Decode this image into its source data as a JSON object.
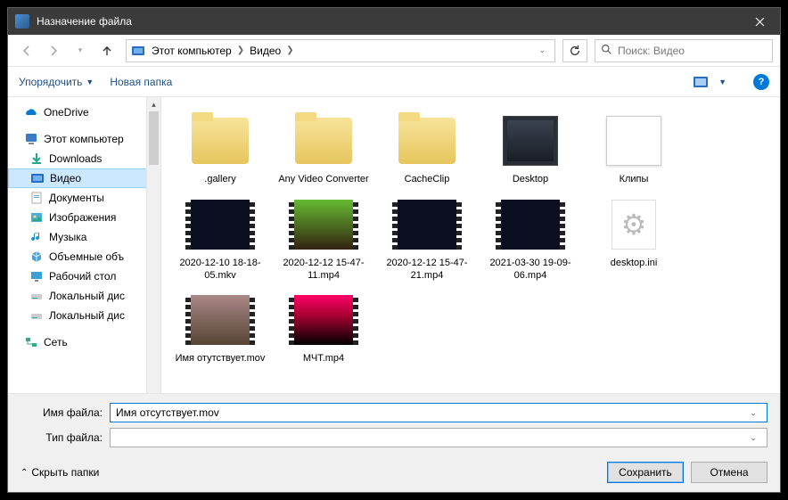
{
  "title": "Назначение файла",
  "breadcrumb": {
    "root": "Этот компьютер",
    "folder": "Видео"
  },
  "search_placeholder": "Поиск: Видео",
  "toolbar": {
    "organize": "Упорядочить",
    "new_folder": "Новая папка"
  },
  "sidebar": {
    "onedrive": "OneDrive",
    "this_pc": "Этот компьютер",
    "items": [
      {
        "label": "Downloads"
      },
      {
        "label": "Видео"
      },
      {
        "label": "Документы"
      },
      {
        "label": "Изображения"
      },
      {
        "label": "Музыка"
      },
      {
        "label": "Объемные объ"
      },
      {
        "label": "Рабочий стол"
      },
      {
        "label": "Локальный дис"
      },
      {
        "label": "Локальный дис"
      }
    ],
    "network": "Сеть"
  },
  "files": [
    {
      "label": ".gallery"
    },
    {
      "label": "Any Video Converter"
    },
    {
      "label": "CacheClip"
    },
    {
      "label": "Desktop"
    },
    {
      "label": "Клипы"
    },
    {
      "label": "2020-12-10 18-18-05.mkv"
    },
    {
      "label": "2020-12-12 15-47-11.mp4"
    },
    {
      "label": "2020-12-12 15-47-21.mp4"
    },
    {
      "label": "2021-03-30 19-09-06.mp4"
    },
    {
      "label": "desktop.ini"
    },
    {
      "label": "Имя отутствует.mov"
    },
    {
      "label": "МЧТ.mp4"
    }
  ],
  "footer": {
    "filename_label": "Имя файла:",
    "filename_value": "Имя отсутствует.mov",
    "filetype_label": "Тип файла:",
    "hide_folders": "Скрыть папки",
    "save": "Сохранить",
    "cancel": "Отмена"
  }
}
